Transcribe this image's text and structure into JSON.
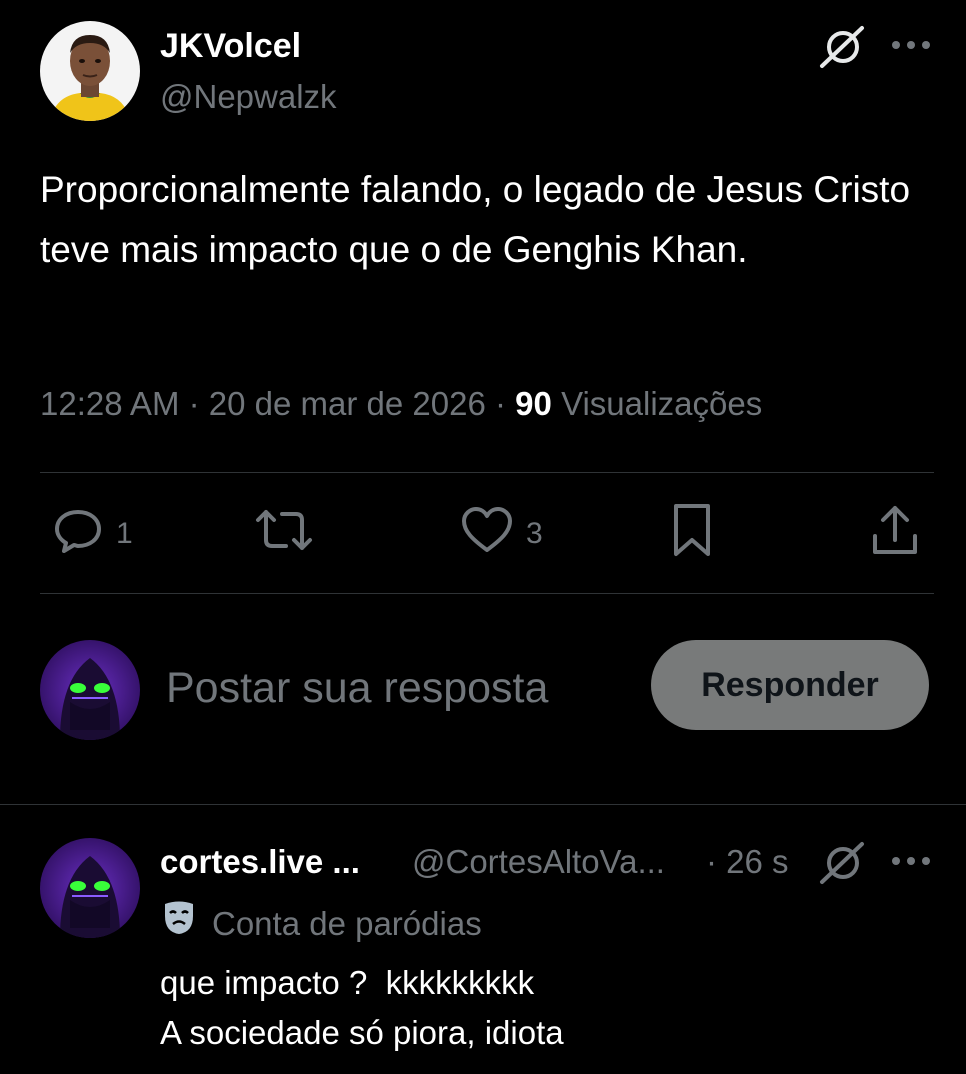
{
  "post": {
    "author_name": "JKVolcel",
    "author_handle": "@Nepwalzk",
    "text": "Proporcionalmente falando, o legado de Jesus Cristo teve mais impacto que o de Genghis Khan.",
    "time": "12:28 AM",
    "date": "20 de mar de 2026",
    "views_count": "90",
    "views_label": "Visualizações",
    "separator": "·",
    "icons": {
      "grok": "grok-slash-icon",
      "more": "more-dots-icon"
    }
  },
  "actions": {
    "reply_count": "1",
    "repost_count": "",
    "like_count": "3",
    "icons": [
      "reply-icon",
      "repost-icon",
      "like-icon",
      "bookmark-icon",
      "share-icon"
    ]
  },
  "composer": {
    "placeholder": "Postar sua resposta",
    "reply_button_label": "Responder"
  },
  "comment": {
    "author_name": "cortes.live ...",
    "author_handle": "@CortesAltoVa...",
    "time": "· 26 s",
    "parody_label": "Conta de paródias",
    "lines": [
      "que impacto ?  kkkkkkkkk",
      "A sociedade só piora, idiota"
    ]
  },
  "colors": {
    "background": "#000000",
    "text_primary": "#ffffff",
    "text_secondary": "#71767b",
    "divider": "#2f3336",
    "reply_button_bg": "#787a7a"
  }
}
